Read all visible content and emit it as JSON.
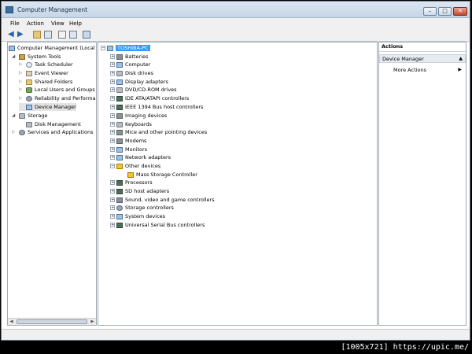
{
  "window": {
    "title": "Computer Management",
    "buttons": {
      "minimize": "–",
      "maximize": "□",
      "close": "✕"
    }
  },
  "menu": [
    "File",
    "Action",
    "View",
    "Help"
  ],
  "toolbar_icons": [
    "back-arrow-icon",
    "forward-arrow-icon",
    "up-folder-icon",
    "show-hide-tree-icon",
    "help-icon",
    "properties-icon",
    "export-icon"
  ],
  "left_tree": {
    "root": "Computer Management (Local",
    "system_tools": "System Tools",
    "items": [
      "Task Scheduler",
      "Event Viewer",
      "Shared Folders",
      "Local Users and Groups",
      "Reliability and Performa",
      "Device Manager"
    ],
    "storage": "Storage",
    "disk_management": "Disk Management",
    "services": "Services and Applications"
  },
  "device_tree": {
    "computer": "TOSHIBA-PC",
    "categories": [
      "Batteries",
      "Computer",
      "Disk drives",
      "Display adapters",
      "DVD/CD-ROM drives",
      "IDE ATA/ATAPI controllers",
      "IEEE 1394 Bus host controllers",
      "Imaging devices",
      "Keyboards",
      "Mice and other pointing devices",
      "Modems",
      "Monitors",
      "Network adapters",
      "Other devices"
    ],
    "other_child": "Mass Storage Controller",
    "categories_after": [
      "Processors",
      "SD host adapters",
      "Sound, video and game controllers",
      "Storage controllers",
      "System devices",
      "Universal Serial Bus controllers"
    ]
  },
  "actions": {
    "header": "Actions",
    "section": "Device Manager",
    "more": "More Actions"
  },
  "footer": "[1005x721] https://upic.me/",
  "colors": {
    "selection": "#3399ff",
    "title_gradient_top": "#dbe6f2"
  }
}
